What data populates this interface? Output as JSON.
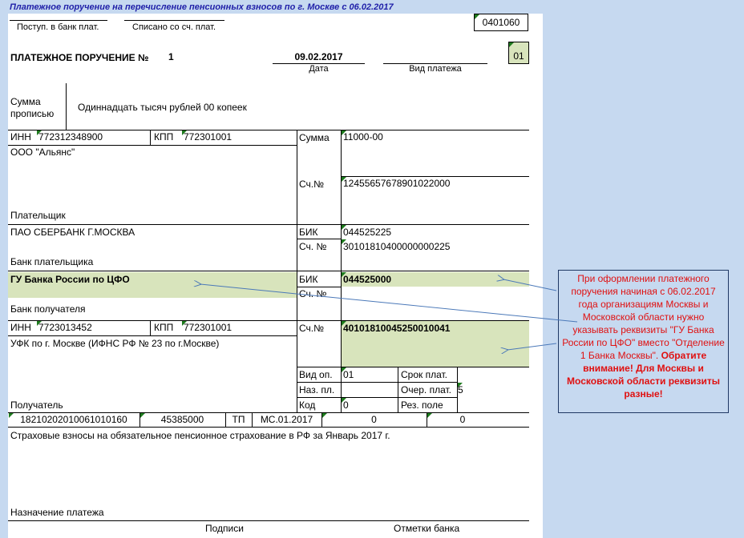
{
  "header": {
    "title": "Платежное поручение на перечисление пенсионных взносов по г. Москве с 06.02.2017"
  },
  "form": {
    "okud": "0401060",
    "received_label": "Поступ. в банк плат.",
    "debited_label": "Списано со сч. плат.",
    "title": "ПЛАТЕЖНОЕ ПОРУЧЕНИЕ №",
    "number": "1",
    "date": "09.02.2017",
    "date_label": "Дата",
    "payment_type_label": "Вид платежа",
    "status": "01",
    "amount_words_label_1": "Сумма",
    "amount_words_label_2": "прописью",
    "amount_words": "Одиннадцать тысяч рублей 00 копеек",
    "inn_label": "ИНН",
    "kpp_label": "КПП",
    "payer_inn": "772312348900",
    "payer_kpp": "772301001",
    "payer_name": "ООО \"Альянс\"",
    "payer_label": "Плательщик",
    "sum_label": "Сумма",
    "sum": "11000-00",
    "account_label": "Сч.№",
    "payer_account": "12455657678901022000",
    "payer_bank": "ПАО СБЕРБАНК Г.МОСКВА",
    "payer_bank_label": "Банк плательщика",
    "bik_label": "БИК",
    "payer_bik": "044525225",
    "corr_account_label": "Сч. №",
    "payer_corr_account": "30101810400000000225",
    "payee_bank": "ГУ Банка России по ЦФО",
    "payee_bank_label": "Банк получателя",
    "payee_bik": "044525000",
    "payee_corr_label": "Сч. №",
    "payee_inn": "7723013452",
    "payee_kpp": "772301001",
    "payee_name": "УФК по г. Москве (ИФНС РФ № 23 по г.Москве)",
    "payee_account_label": "Сч.№",
    "payee_account": "40101810045250010041",
    "payee_label": "Получатель",
    "op_type_label": "Вид оп.",
    "op_type": "01",
    "purpose_code_label": "Наз. пл.",
    "code_label": "Код",
    "code": "0",
    "due_label": "Срок плат.",
    "queue_label": "Очер. плат.",
    "queue": "5",
    "reserve_label": "Рез. поле",
    "kbk": "18210202010061010160",
    "oktmo": "45385000",
    "basis": "ТП",
    "period": "МС.01.2017",
    "doc_number": "0",
    "doc_date": "0",
    "purpose": "Страховые взносы на обязательное пенсионное страхование в РФ за Январь 2017 г.",
    "purpose_label": "Назначение платежа",
    "signatures_label": "Подписи",
    "bank_marks_label": "Отметки банка"
  },
  "note": {
    "text": "При оформлении платежного поручения начиная с 06.02.2017 года организациям Москвы и Московской области нужно указывать реквизиты \"ГУ Банка России  по ЦФО\" вместо \"Отделение 1 Банка Москвы\".",
    "warning": "Обратите внимание! Для Москвы и Московской области реквизиты разные!"
  },
  "colors": {
    "background": "#c6d9f0",
    "highlight": "#d8e4bc",
    "header_text": "#1f1fa8",
    "note_text": "#e01010"
  }
}
